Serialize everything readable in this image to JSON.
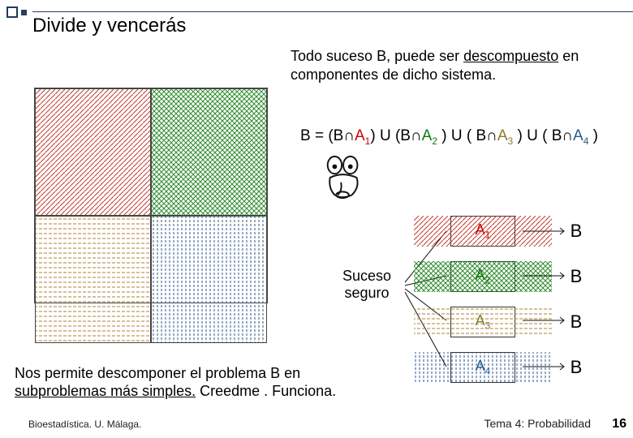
{
  "title": "Divide y vencerás",
  "intro": {
    "pre": "Todo suceso B, puede ser ",
    "u": "descompuesto",
    "post": " en componentes de dicho sistema."
  },
  "formula": {
    "lead": "B = (B∩",
    "a1": "A",
    "mid1": ") U (B∩",
    "a2": "A",
    "mid2": " ) U ( B∩",
    "a3": "A",
    "mid3": " ) U ( B∩",
    "a4": "A",
    "tail": " )",
    "s1": "1",
    "s2": "2",
    "s3": "3",
    "s4": "4"
  },
  "suceso": {
    "l1": "Suceso",
    "l2": "seguro"
  },
  "rows": {
    "a": "A",
    "sub": [
      "1",
      "2",
      "3",
      "4"
    ],
    "b": "B"
  },
  "bottom": {
    "p1": "Nos permite descomponer el problema B en",
    "p2a": "subproblemas más simples.",
    "p2b": " Creedme . Funciona."
  },
  "footer": {
    "left": "Bioestadística. U. Málaga.",
    "right": "Tema 4: Probabilidad",
    "page": "16"
  }
}
